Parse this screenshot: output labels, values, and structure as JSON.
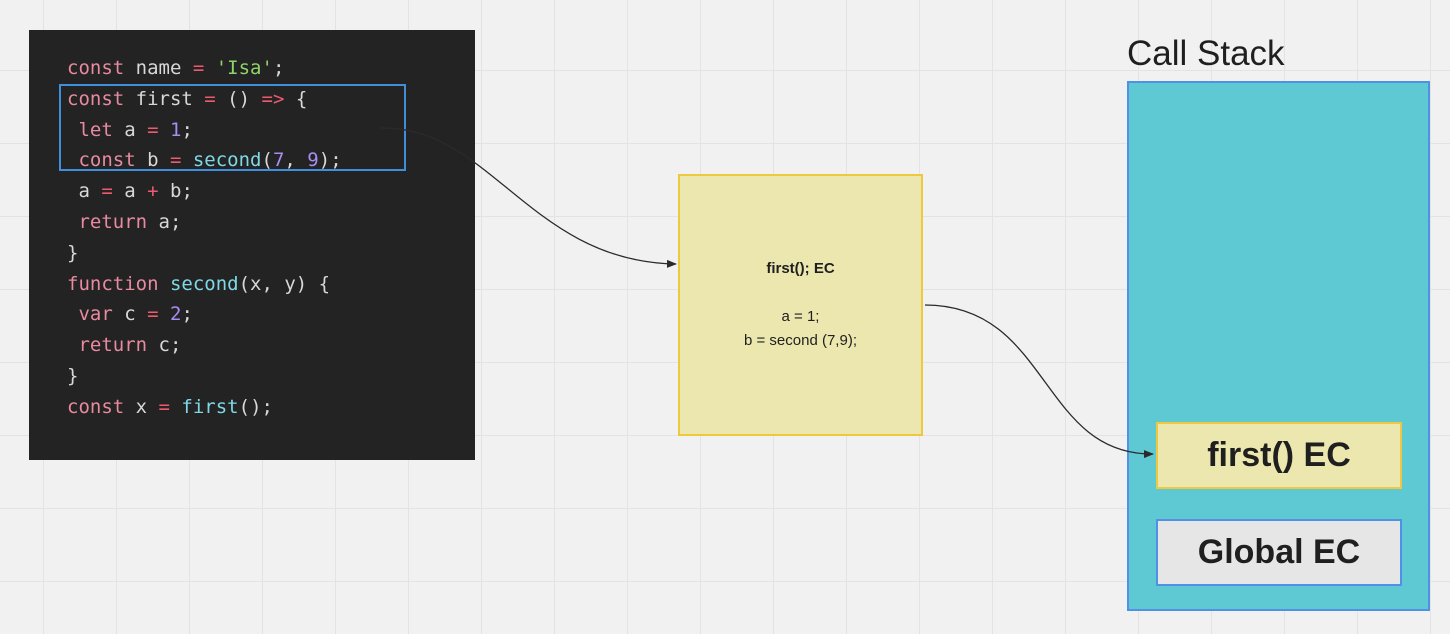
{
  "code": {
    "lines": [
      [
        [
          "kw",
          "const"
        ],
        [
          "id",
          " name "
        ],
        [
          "op",
          "="
        ],
        [
          "str",
          " 'Isa'"
        ],
        [
          "pn",
          ";"
        ]
      ],
      [
        [
          "kw",
          "const"
        ],
        [
          "id",
          " first "
        ],
        [
          "op",
          "="
        ],
        [
          "pn",
          " () "
        ],
        [
          "op",
          "=>"
        ],
        [
          "pn",
          " {"
        ]
      ],
      [
        [
          "kw",
          " let"
        ],
        [
          "id",
          " a "
        ],
        [
          "op",
          "="
        ],
        [
          "num",
          " 1"
        ],
        [
          "pn",
          ";"
        ]
      ],
      [
        [
          "kw",
          " const"
        ],
        [
          "id",
          " b "
        ],
        [
          "op",
          "="
        ],
        [
          "fn",
          " second"
        ],
        [
          "pn",
          "("
        ],
        [
          "num",
          "7"
        ],
        [
          "pn",
          ", "
        ],
        [
          "num",
          "9"
        ],
        [
          "pn",
          ");"
        ]
      ],
      [
        [
          "id",
          " a "
        ],
        [
          "op",
          "="
        ],
        [
          "id",
          " a "
        ],
        [
          "op",
          "+"
        ],
        [
          "id",
          " b"
        ],
        [
          "pn",
          ";"
        ]
      ],
      [
        [
          "kw",
          " return"
        ],
        [
          "id",
          " a"
        ],
        [
          "pn",
          ";"
        ]
      ],
      [
        [
          "pn",
          "}"
        ]
      ],
      [
        [
          "kw",
          "function"
        ],
        [
          "fn",
          " second"
        ],
        [
          "pn",
          "(x, y) {"
        ]
      ],
      [
        [
          "kw",
          " var"
        ],
        [
          "id",
          " c "
        ],
        [
          "op",
          "="
        ],
        [
          "num",
          " 2"
        ],
        [
          "pn",
          ";"
        ]
      ],
      [
        [
          "kw",
          " return"
        ],
        [
          "id",
          " c"
        ],
        [
          "pn",
          ";"
        ]
      ],
      [
        [
          "pn",
          "}"
        ]
      ],
      [
        [
          "kw",
          "const"
        ],
        [
          "id",
          " x "
        ],
        [
          "op",
          "="
        ],
        [
          "fn",
          " first"
        ],
        [
          "pn",
          "();"
        ]
      ]
    ]
  },
  "ec_note": {
    "title": "first(); EC",
    "line1": "a = 1;",
    "line2": "b = second (7,9);"
  },
  "call_stack": {
    "title": "Call Stack",
    "frames": [
      "first() EC",
      "Global EC"
    ]
  },
  "colors": {
    "code_bg": "#232323",
    "highlight_border": "#3f8fdc",
    "note_bg": "#ebe7ae",
    "note_border": "#ecc93f",
    "stack_bg": "#5ec8d3",
    "stack_border": "#4e91e6",
    "global_bg": "#e6e6e6"
  }
}
